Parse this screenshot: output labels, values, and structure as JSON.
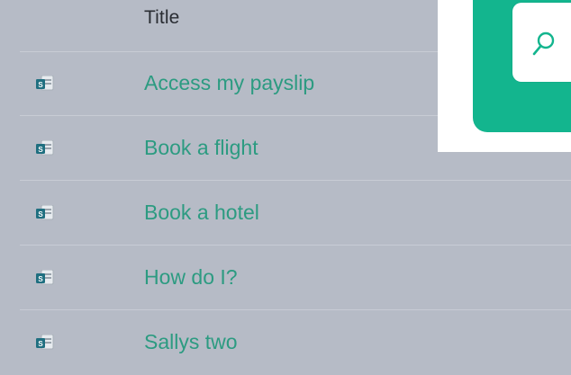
{
  "list": {
    "header": {
      "title": "Title"
    },
    "rows": [
      {
        "title": "Access my payslip",
        "icon": "sharepoint-page-icon"
      },
      {
        "title": "Book a flight",
        "icon": "sharepoint-page-icon"
      },
      {
        "title": "Book a hotel",
        "icon": "sharepoint-page-icon"
      },
      {
        "title": "How do I?",
        "icon": "sharepoint-page-icon"
      },
      {
        "title": "Sallys two",
        "icon": "sharepoint-page-icon"
      }
    ]
  },
  "popup": {
    "search_icon": "search-icon"
  },
  "colors": {
    "background": "#b6bbc6",
    "link": "#2c9b81",
    "accent": "#13b58e",
    "icon_blue": "#1f6f80"
  }
}
